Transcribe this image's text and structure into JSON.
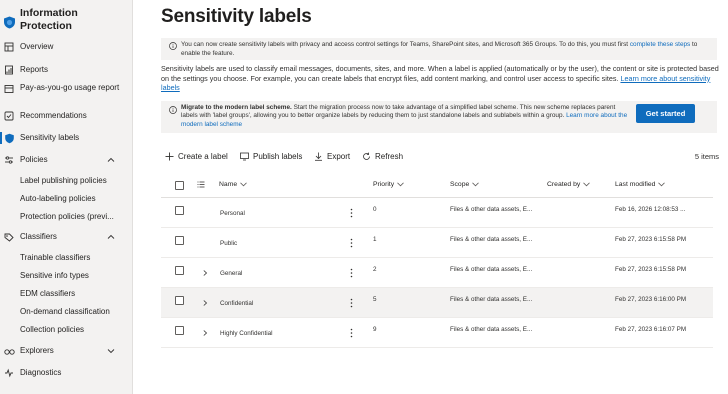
{
  "sidebar": {
    "brand": "Information Protection",
    "items": [
      {
        "label": "Overview",
        "icon": "overview-icon"
      },
      {
        "label": "Reports",
        "icon": "reports-icon"
      },
      {
        "label": "Pay-as-you-go usage report",
        "icon": "usage-icon"
      },
      {
        "label": "Recommendations",
        "icon": "recommendations-icon"
      },
      {
        "label": "Sensitivity labels",
        "icon": "sensitivity-labels-icon"
      },
      {
        "label": "Policies",
        "icon": "policies-icon"
      },
      {
        "label": "Classifiers",
        "icon": "classifiers-icon"
      },
      {
        "label": "Explorers",
        "icon": "explorers-icon"
      },
      {
        "label": "Diagnostics",
        "icon": "diagnostics-icon"
      }
    ],
    "policies_sub": [
      "Label publishing policies",
      "Auto-labeling policies",
      "Protection policies (previ..."
    ],
    "classifiers_sub": [
      "Trainable classifiers",
      "Sensitive info types",
      "EDM classifiers",
      "On-demand classification",
      "Collection policies"
    ]
  },
  "page": {
    "title": "Sensitivity labels",
    "info_text": "You can now create sensitivity labels with privacy and access control settings for Teams, SharePoint sites, and Microsoft 365 Groups. To do this, you must first ",
    "info_link": "complete these steps",
    "info_tail": " to enable the feature.",
    "desc_text": "Sensitivity labels are used to classify email messages, documents, sites, and more. When a label is applied (automatically or by the user), the content or site is protected based on the settings you choose. For example, you can create labels that encrypt files, add content marking, and control user access to specific sites. ",
    "desc_link": "Learn more about sensitivity labels",
    "migrate_bold": "Migrate to the modern label scheme.",
    "migrate_text": " Start the migration process now to take advantage of a simplified label scheme. This new scheme replaces parent labels with 'label groups', allowing you to better organize labels by reducing them to just standalone labels and sublabels within a group. ",
    "migrate_link": "Learn more about the modern label scheme",
    "get_started": "Get started"
  },
  "toolbar": {
    "create": "Create a label",
    "publish": "Publish labels",
    "export": "Export",
    "refresh": "Refresh",
    "count": "5 items"
  },
  "table": {
    "headers": {
      "name": "Name",
      "priority": "Priority",
      "scope": "Scope",
      "created_by": "Created by",
      "last_modified": "Last modified"
    },
    "rows": [
      {
        "name": "Personal",
        "priority": "0",
        "scope": "Files & other data assets, E...",
        "created_by": "",
        "modified": "Feb 16, 2026 12:08:53 ...",
        "expandable": false
      },
      {
        "name": "Public",
        "priority": "1",
        "scope": "Files & other data assets, E...",
        "created_by": "",
        "modified": "Feb 27, 2023 6:15:58 PM",
        "expandable": false
      },
      {
        "name": "General",
        "priority": "2",
        "scope": "Files & other data assets, E...",
        "created_by": "",
        "modified": "Feb 27, 2023 6:15:58 PM",
        "expandable": true
      },
      {
        "name": "Confidential",
        "priority": "5",
        "scope": "Files & other data assets, E...",
        "created_by": "",
        "modified": "Feb 27, 2023 6:16:00 PM",
        "expandable": true
      },
      {
        "name": "Highly Confidential",
        "priority": "9",
        "scope": "Files & other data assets, E...",
        "created_by": "",
        "modified": "Feb 27, 2023 6:16:07 PM",
        "expandable": true
      }
    ]
  },
  "colors": {
    "accent": "#0f6cbd",
    "sidebar_bg": "#f3f2f1",
    "banner_bg": "#f3f2f1"
  }
}
